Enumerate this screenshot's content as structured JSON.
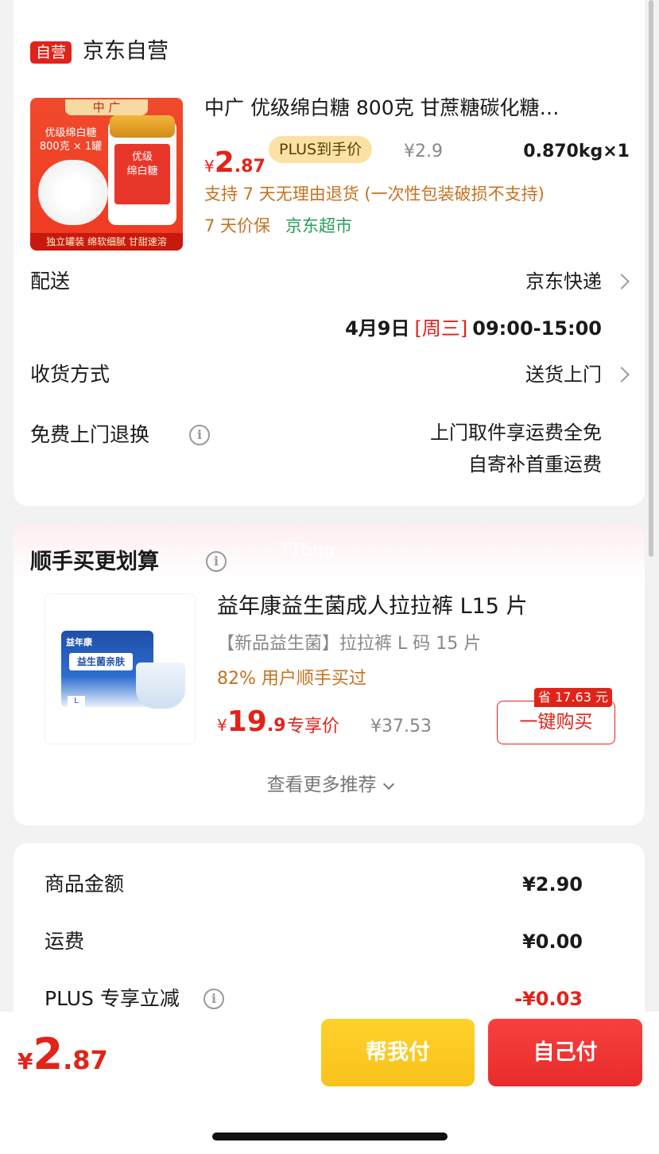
{
  "store": {
    "badge": "自营",
    "name": "京东自营"
  },
  "product": {
    "image": {
      "brand": "中 广",
      "label_left": "优级绵白糖\n800克 × 1罐",
      "jar_label": "优级\n绵白糖",
      "bottom": "独立罐装  绵软细腻  甘甜速溶"
    },
    "title": "中广 优级绵白糖 800克 甘蔗糖碳化糖…",
    "price_symbol": "¥",
    "price_int": "2",
    "price_dec": ".87",
    "plus_badge": "PLUS到手价",
    "original_price": "¥2.9",
    "quantity": "0.870kg×1",
    "return_policy": "支持 7 天无理由退货 (一次性包装破损不支持)",
    "price_protect": "7 天价保",
    "supermarket": "京东超市"
  },
  "delivery": {
    "label": "配送",
    "carrier": "京东快递",
    "date": "4月9日",
    "weekday": "[周三]",
    "time": "09:00-15:00"
  },
  "receive": {
    "label": "收货方式",
    "value": "送货上门"
  },
  "free_return": {
    "label": "免费上门退换",
    "line1": "上门取件享运费全免",
    "line2": "自寄补首重运费"
  },
  "recommend": {
    "section_title": "顺手买更划算",
    "watermark": "TTting",
    "item": {
      "image": {
        "brand": "益年康",
        "pack_label": "益生菌亲肤",
        "size": "L"
      },
      "title": "益年康益生菌成人拉拉裤 L15 片",
      "subtitle": "【新品益生菌】拉拉裤 L 码 15 片",
      "stat": "82% 用户顺手买过",
      "price_symbol": "¥",
      "price_int": "19",
      "price_dec": ".9",
      "price_tag": "专享价",
      "original_price": "¥37.53",
      "save_badge": "省 17.63 元",
      "buy_button": "一键购买"
    },
    "more_label": "查看更多推荐"
  },
  "summary": {
    "goods_label": "商品金额",
    "goods_value": "¥2.90",
    "shipping_label": "运费",
    "shipping_value": "¥0.00",
    "plus_label": "PLUS 专享立减",
    "plus_value": "-¥0.03",
    "plus_value_color": "#e2231a"
  },
  "bottom_bar": {
    "total_symbol": "¥",
    "total_int": "2",
    "total_dec": ".87",
    "help_pay": "帮我付",
    "self_pay": "自己付"
  },
  "colors": {
    "accent_red": "#e2231a",
    "orange_text": "#c7711e",
    "green_text": "#25a05a",
    "plus_badge_bg": "#fbe2a4",
    "help_pay_bg": "#fdd22b"
  }
}
